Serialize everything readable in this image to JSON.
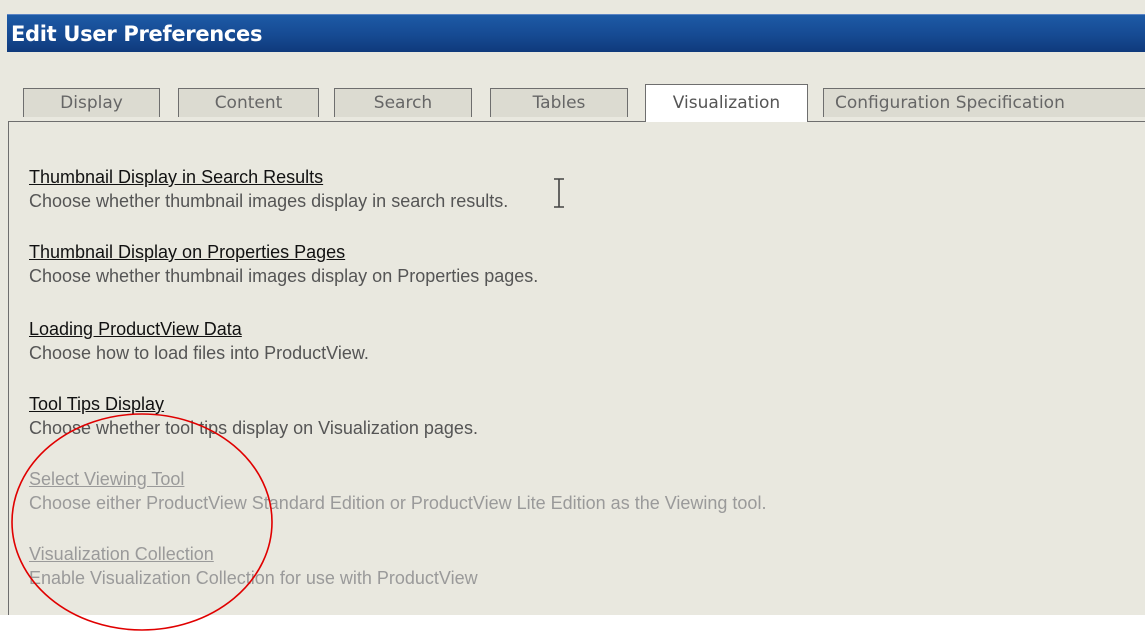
{
  "window": {
    "title": "Edit User Preferences"
  },
  "tabs": [
    {
      "label": "Display",
      "active": false
    },
    {
      "label": "Content",
      "active": false
    },
    {
      "label": "Search",
      "active": false
    },
    {
      "label": "Tables",
      "active": false
    },
    {
      "label": "Visualization",
      "active": true
    },
    {
      "label": "Configuration Specification",
      "active": false
    }
  ],
  "preferences": [
    {
      "title": "Thumbnail Display in Search Results",
      "description": "Choose whether thumbnail images display in search results.",
      "enabled": true
    },
    {
      "title": "Thumbnail Display on Properties Pages",
      "description": "Choose whether thumbnail images display on Properties pages.",
      "enabled": true
    },
    {
      "title": "Loading ProductView Data",
      "description": "Choose how to load files into ProductView.",
      "enabled": true
    },
    {
      "title": "Tool Tips Display",
      "description": "Choose whether tool tips display on Visualization pages.",
      "enabled": true
    },
    {
      "title": "Select Viewing Tool",
      "description": "Choose either ProductView Standard Edition or ProductView Lite Edition as the Viewing tool.",
      "enabled": false
    },
    {
      "title": "Visualization Collection",
      "description": "Enable Visualization Collection for use with ProductView",
      "enabled": false
    }
  ],
  "annotation": {
    "color": "#e00000",
    "shape": "ellipse"
  },
  "colors": {
    "title_bar": "#164a92",
    "title_text": "#ffffff",
    "background": "#e9e8df",
    "link_enabled": "#111111",
    "text_disabled": "#9a9a9a"
  },
  "icons": {
    "cursor": "text-cursor-icon"
  }
}
